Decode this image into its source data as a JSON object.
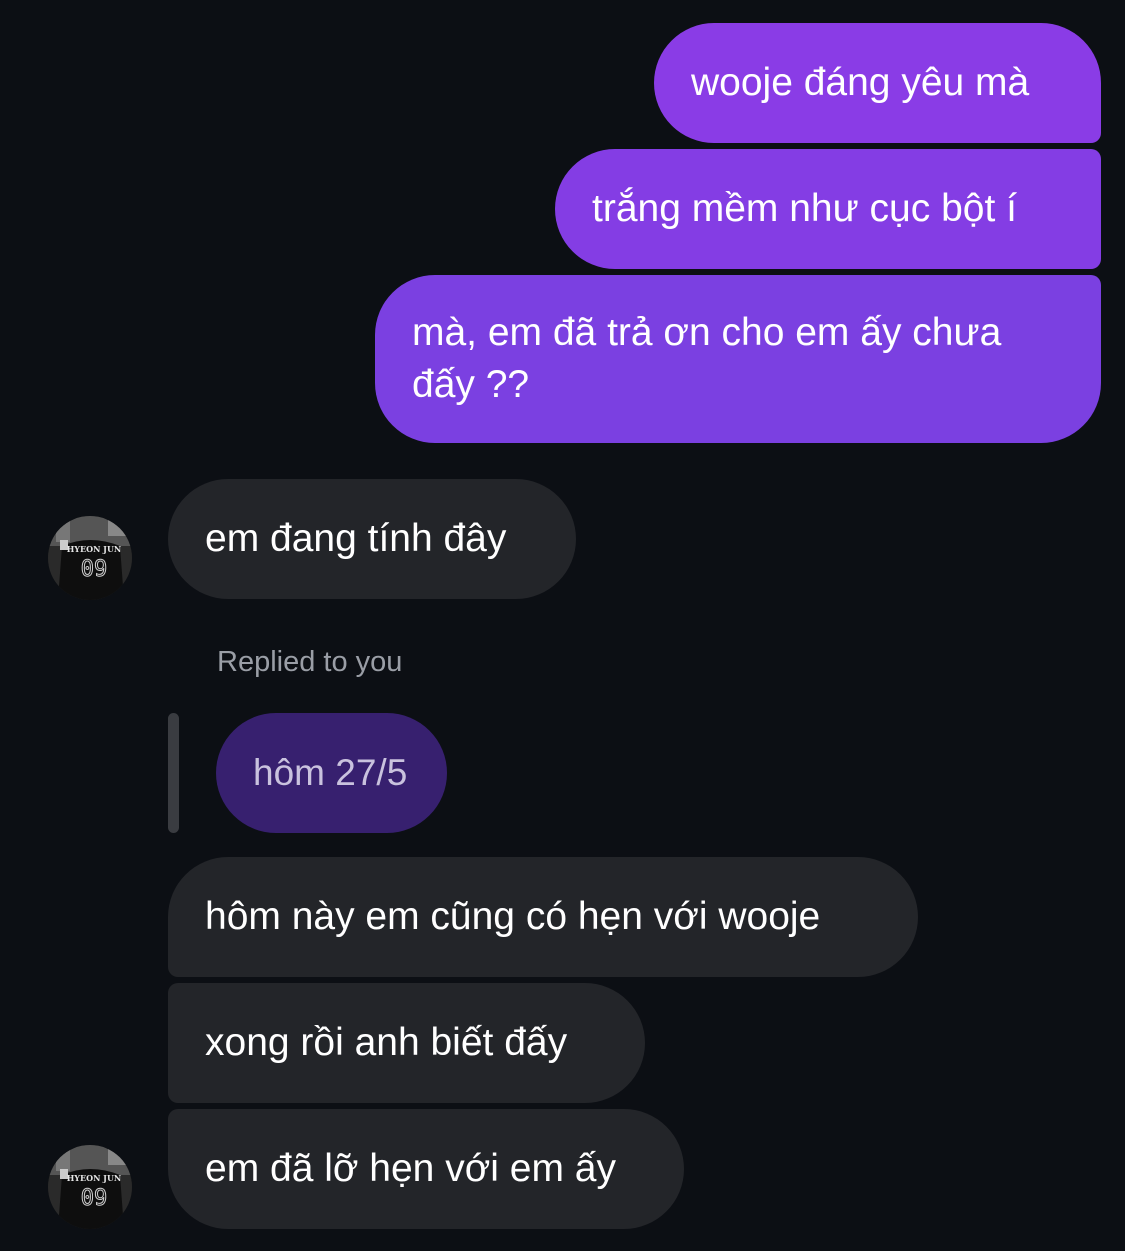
{
  "conversation": {
    "sent_messages": [
      {
        "text": "wooje đáng yêu mà"
      },
      {
        "text": "trắng mềm như cục bột í"
      },
      {
        "text_line1": "mà, em đã trả ơn cho em ấy chưa",
        "text_line2": "đấy ??"
      }
    ],
    "received_messages": [
      {
        "text": "em đang tính đây"
      },
      {
        "text": "hôm này em cũng có hẹn với wooje"
      },
      {
        "text": "xong rồi anh biết đấy"
      },
      {
        "text": "em đã lỡ hẹn với em ấy"
      }
    ],
    "reply": {
      "label": "Replied to you",
      "quoted_text": "hôm 27/5"
    },
    "avatar": {
      "shirt_name": "HYEON JUN",
      "shirt_number": "09"
    }
  },
  "colors": {
    "background": "#0c0f14",
    "sent_bubble_top": "#8a3ee6",
    "sent_bubble_bottom": "#7840e0",
    "received_bubble": "#232529",
    "quoted_bubble": "#37206f",
    "reply_label": "#9a9ea6"
  }
}
